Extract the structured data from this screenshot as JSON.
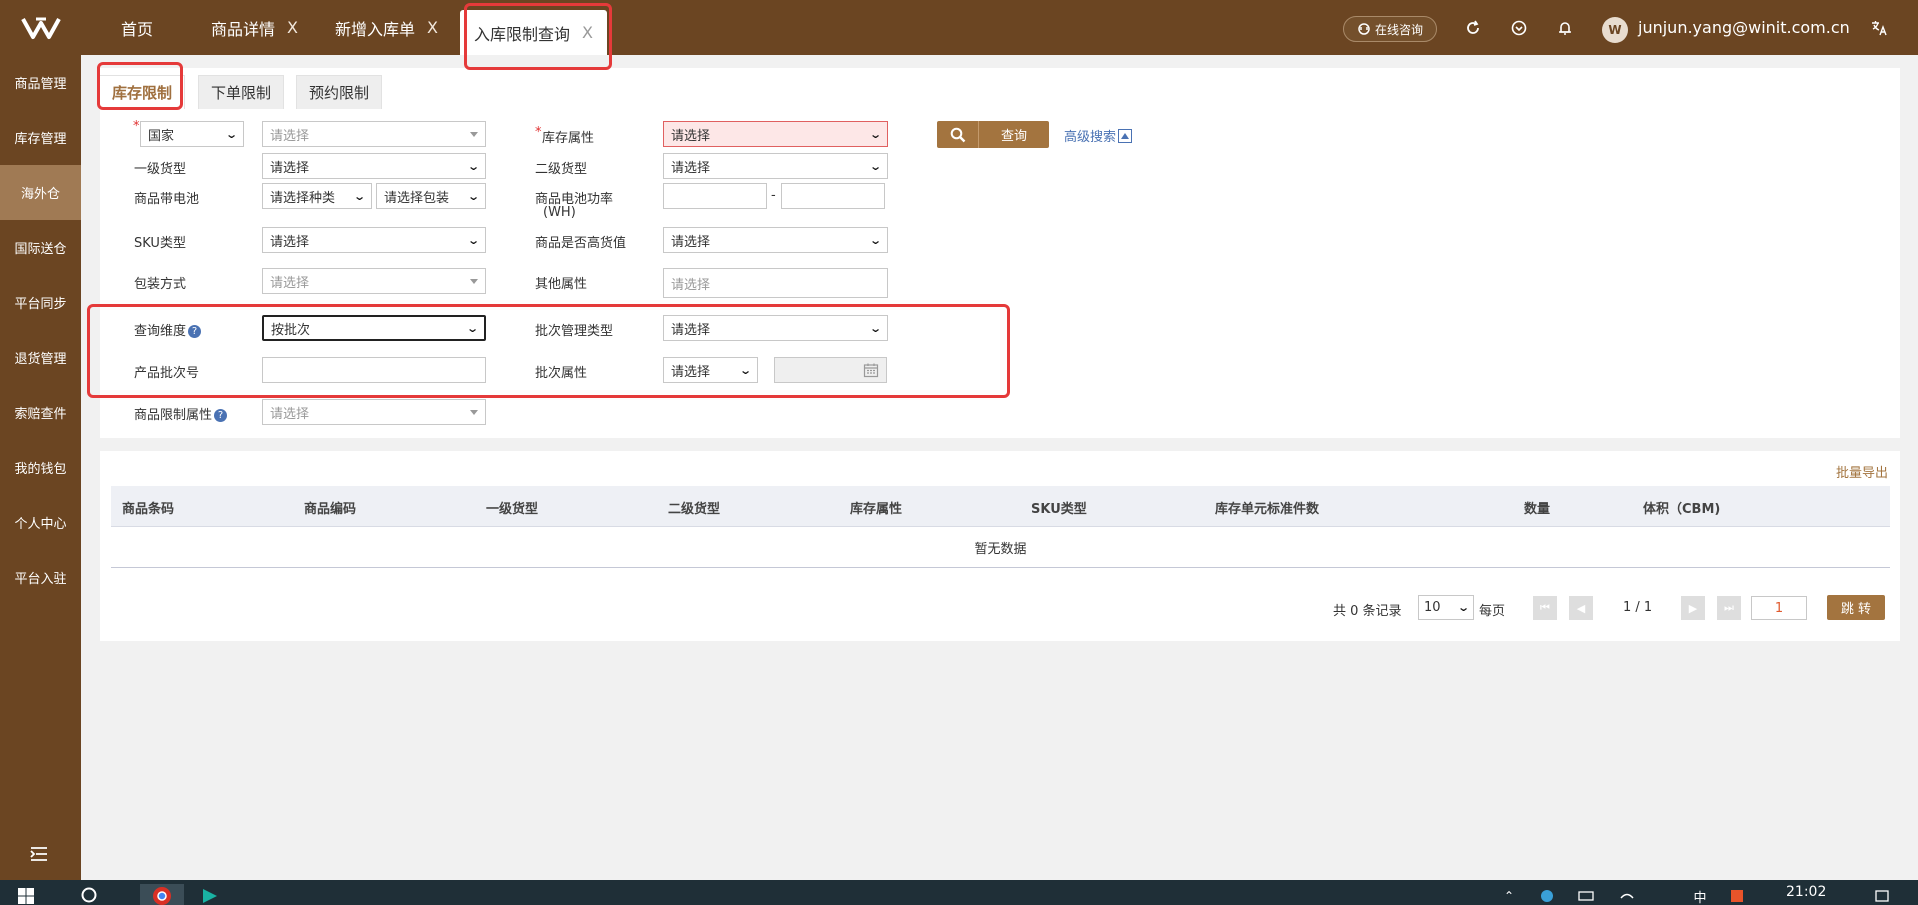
{
  "header": {
    "tabs": [
      {
        "label": "首页",
        "closable": false
      },
      {
        "label": "商品详情",
        "closable": true
      },
      {
        "label": "新增入库单",
        "closable": true
      },
      {
        "label": "入库限制查询",
        "closable": true,
        "active": true
      }
    ],
    "close_glyph": "X",
    "consult_label": "在线咨询",
    "avatar_text": "W",
    "user_email": "junjun.yang@winit.com.cn",
    "icons": [
      "refresh-icon",
      "heart-badge-icon",
      "bell-icon",
      "translate-icon"
    ]
  },
  "sidebar": {
    "items": [
      {
        "label": "商品管理"
      },
      {
        "label": "库存管理"
      },
      {
        "label": "海外仓",
        "active": true
      },
      {
        "label": "国际送仓"
      },
      {
        "label": "平台同步"
      },
      {
        "label": "退货管理"
      },
      {
        "label": "索赔查件"
      },
      {
        "label": "我的钱包"
      },
      {
        "label": "个人中心"
      },
      {
        "label": "平台入驻"
      }
    ]
  },
  "subtabs": [
    {
      "label": "库存限制",
      "active": true
    },
    {
      "label": "下单限制"
    },
    {
      "label": "预约限制"
    }
  ],
  "form": {
    "required_mark": "*",
    "country_select": "国家",
    "country_value": "请选择",
    "stock_attr_label": "库存属性",
    "stock_attr_value": "请选择",
    "level1_label": "一级货型",
    "level1_value": "请选择",
    "level2_label": "二级货型",
    "level2_value": "请选择",
    "battery_label": "商品带电池",
    "battery_type_value": "请选择种类",
    "battery_pack_value": "请选择包装",
    "battery_power_label": "商品电池功率",
    "battery_power_unit": "(WH)",
    "range_sep": "-",
    "sku_type_label": "SKU类型",
    "sku_type_value": "请选择",
    "high_value_label": "商品是否高货值",
    "high_value_value": "请选择",
    "packing_label": "包装方式",
    "packing_value": "请选择",
    "other_attr_label": "其他属性",
    "other_attr_placeholder": "请选择",
    "dimension_label": "查询维度",
    "dimension_value": "按批次",
    "batch_mgmt_label": "批次管理类型",
    "batch_mgmt_value": "请选择",
    "batch_no_label": "产品批次号",
    "batch_no_value": "",
    "batch_attr_label": "批次属性",
    "batch_attr_value": "请选择",
    "limit_attr_label": "商品限制属性",
    "limit_attr_value": "请选择",
    "help_glyph": "?",
    "query_label": "查询",
    "advanced_label": "高级搜索"
  },
  "results": {
    "export_label": "批量导出",
    "columns": [
      "商品条码",
      "商品编码",
      "一级货型",
      "二级货型",
      "库存属性",
      "SKU类型",
      "库存单元标准件数",
      "数量",
      "体积（CBM)"
    ],
    "empty_text": "暂无数据"
  },
  "pagination": {
    "total_text": "共 0 条记录",
    "page_size": "10",
    "per_page_label": "每页",
    "page_info": "1 / 1",
    "jump_value": "1",
    "jump_label": "跳 转"
  },
  "taskbar": {
    "time": "21:02",
    "ime": "中"
  },
  "colors": {
    "brand": "#6b4522",
    "accent": "#a3743f",
    "highlight": "#e53a3a",
    "link": "#4a72b3"
  }
}
